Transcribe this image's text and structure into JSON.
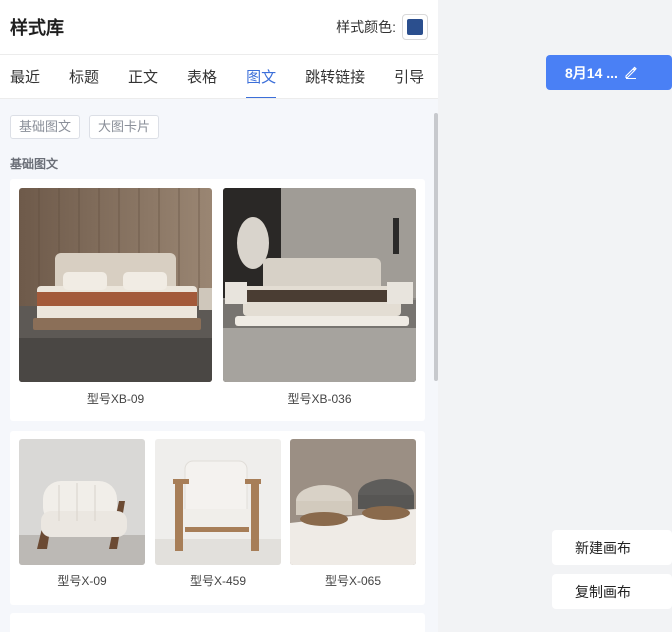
{
  "panel": {
    "title": "样式库",
    "color_label": "样式颜色:",
    "color_value": "#2b4f8e"
  },
  "tabs": [
    {
      "label": "最近"
    },
    {
      "label": "标题"
    },
    {
      "label": "正文"
    },
    {
      "label": "表格"
    },
    {
      "label": "图文",
      "active": true
    },
    {
      "label": "跳转链接"
    },
    {
      "label": "引导"
    }
  ],
  "filters": [
    "基础图文",
    "大图卡片"
  ],
  "section": {
    "label": "基础图文"
  },
  "cards": [
    {
      "items": [
        {
          "name": "型号XB-09",
          "icon": "bed-image"
        },
        {
          "name": "型号XB-036",
          "icon": "bed-image"
        }
      ]
    },
    {
      "items": [
        {
          "name": "型号X-09",
          "icon": "armchair-image"
        },
        {
          "name": "型号X-459",
          "icon": "armchair-image"
        },
        {
          "name": "型号X-065",
          "icon": "ottoman-image"
        }
      ]
    }
  ],
  "canvas": {
    "date_button": "8月14 ...",
    "edit_icon": "pencil-icon",
    "new_canvas": "新建画布",
    "copy_canvas": "复制画布"
  },
  "colors": {
    "accent": "#3c6fd9",
    "button": "#4a80f5"
  }
}
